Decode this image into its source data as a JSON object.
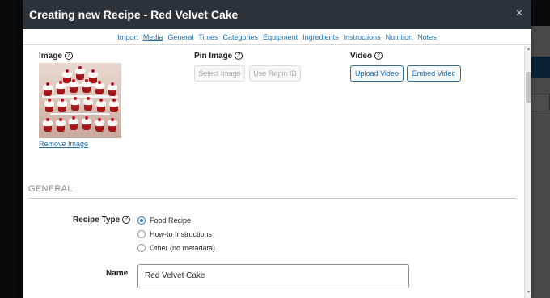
{
  "modal": {
    "title": "Creating new Recipe - Red Velvet Cake",
    "close_glyph": "×"
  },
  "tabs": [
    {
      "label": "Import",
      "active": false
    },
    {
      "label": "Media",
      "active": true
    },
    {
      "label": "General",
      "active": false
    },
    {
      "label": "Times",
      "active": false
    },
    {
      "label": "Categories",
      "active": false
    },
    {
      "label": "Equipment",
      "active": false
    },
    {
      "label": "Ingredients",
      "active": false
    },
    {
      "label": "Instructions",
      "active": false
    },
    {
      "label": "Nutrition",
      "active": false
    },
    {
      "label": "Notes",
      "active": false
    }
  ],
  "media": {
    "image_label": "Image",
    "remove_image": "Remove Image",
    "pin_image_label": "Pin Image",
    "select_image": "Select Image",
    "use_repin_id": "Use Repin ID",
    "video_label": "Video",
    "upload_video": "Upload Video",
    "embed_video": "Embed Video"
  },
  "general": {
    "section_title": "GENERAL",
    "recipe_type_label": "Recipe Type",
    "recipe_type_options": [
      {
        "label": "Food Recipe",
        "checked": true
      },
      {
        "label": "How-to Instructions",
        "checked": false
      },
      {
        "label": "Other (no metadata)",
        "checked": false
      }
    ],
    "name_label": "Name",
    "name_value": "Red Velvet Cake"
  },
  "help_glyph": "?",
  "icons": {
    "help": "help-circle-icon",
    "close": "close-icon"
  },
  "colors": {
    "header_bg": "#2c3338",
    "link": "#2271b1",
    "admin_bg": "#1d2327"
  }
}
